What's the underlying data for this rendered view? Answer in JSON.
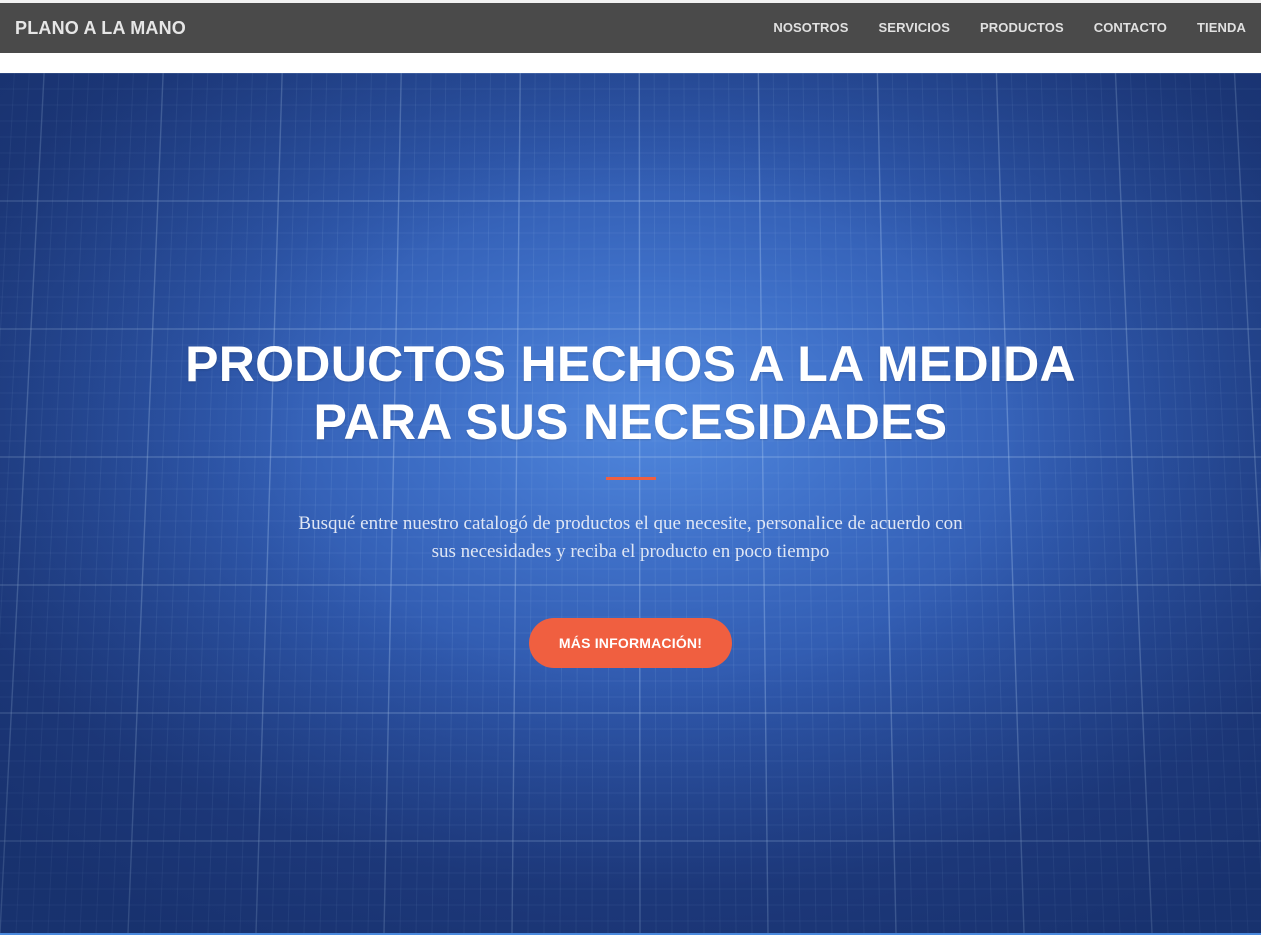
{
  "navbar": {
    "brand": "PLANO A LA MANO",
    "links": [
      "NOSOTROS",
      "SERVICIOS",
      "PRODUCTOS",
      "CONTACTO",
      "TIENDA"
    ]
  },
  "hero": {
    "title_line1": "PRODUCTOS HECHOS A LA MEDIDA",
    "title_line2": "PARA SUS NECESIDADES",
    "subtitle_line1": "Busqué entre nuestro catalogó de productos el que necesite, personalice de acuerdo con",
    "subtitle_line2": "sus necesidades y reciba el producto en poco tiempo",
    "cta_label": "MÁS INFORMACIÓN!"
  },
  "colors": {
    "navbar_bg": "#4a4a4a",
    "accent": "#f05f40",
    "hero_blue": "#3e6fc7"
  }
}
